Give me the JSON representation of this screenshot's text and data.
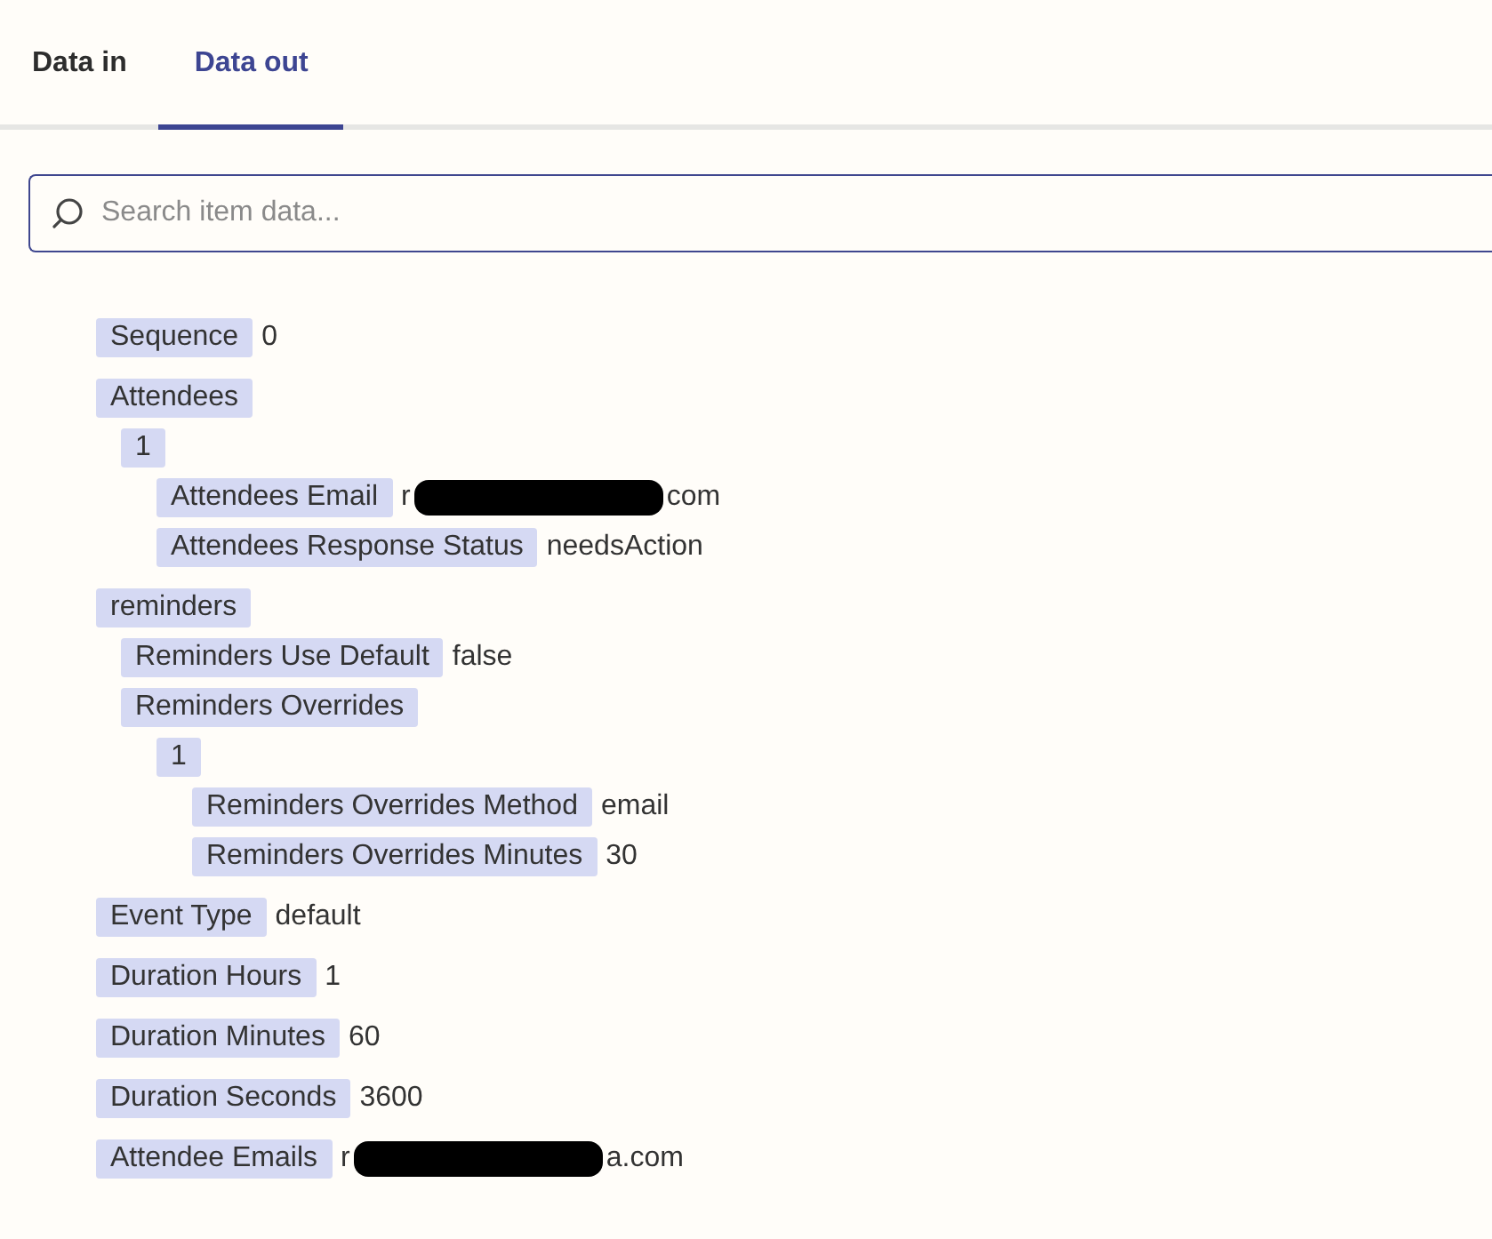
{
  "tabs": [
    {
      "label": "Data in",
      "selected": false
    },
    {
      "label": "Data out",
      "selected": true
    }
  ],
  "search": {
    "placeholder": "Search item data..."
  },
  "items": [
    {
      "key": "Sequence",
      "value": "0"
    },
    {
      "key": "Attendees",
      "children": [
        {
          "key": "1",
          "children": [
            {
              "key": "Attendees Email",
              "value_prefix": "r",
              "value_suffix": "com",
              "redacted": true
            },
            {
              "key": "Attendees Response Status",
              "value": "needsAction"
            }
          ]
        }
      ]
    },
    {
      "key": "reminders",
      "children": [
        {
          "key": "Reminders Use Default",
          "value": "false"
        },
        {
          "key": "Reminders Overrides",
          "children": [
            {
              "key": "1",
              "children": [
                {
                  "key": "Reminders Overrides Method",
                  "value": "email"
                },
                {
                  "key": "Reminders Overrides Minutes",
                  "value": "30"
                }
              ]
            }
          ]
        }
      ]
    },
    {
      "key": "Event Type",
      "value": "default"
    },
    {
      "key": "Duration Hours",
      "value": "1"
    },
    {
      "key": "Duration Minutes",
      "value": "60"
    },
    {
      "key": "Duration Seconds",
      "value": "3600"
    },
    {
      "key": "Attendee Emails",
      "value_prefix": "r",
      "value_suffix": "a.com",
      "redacted": true
    }
  ]
}
